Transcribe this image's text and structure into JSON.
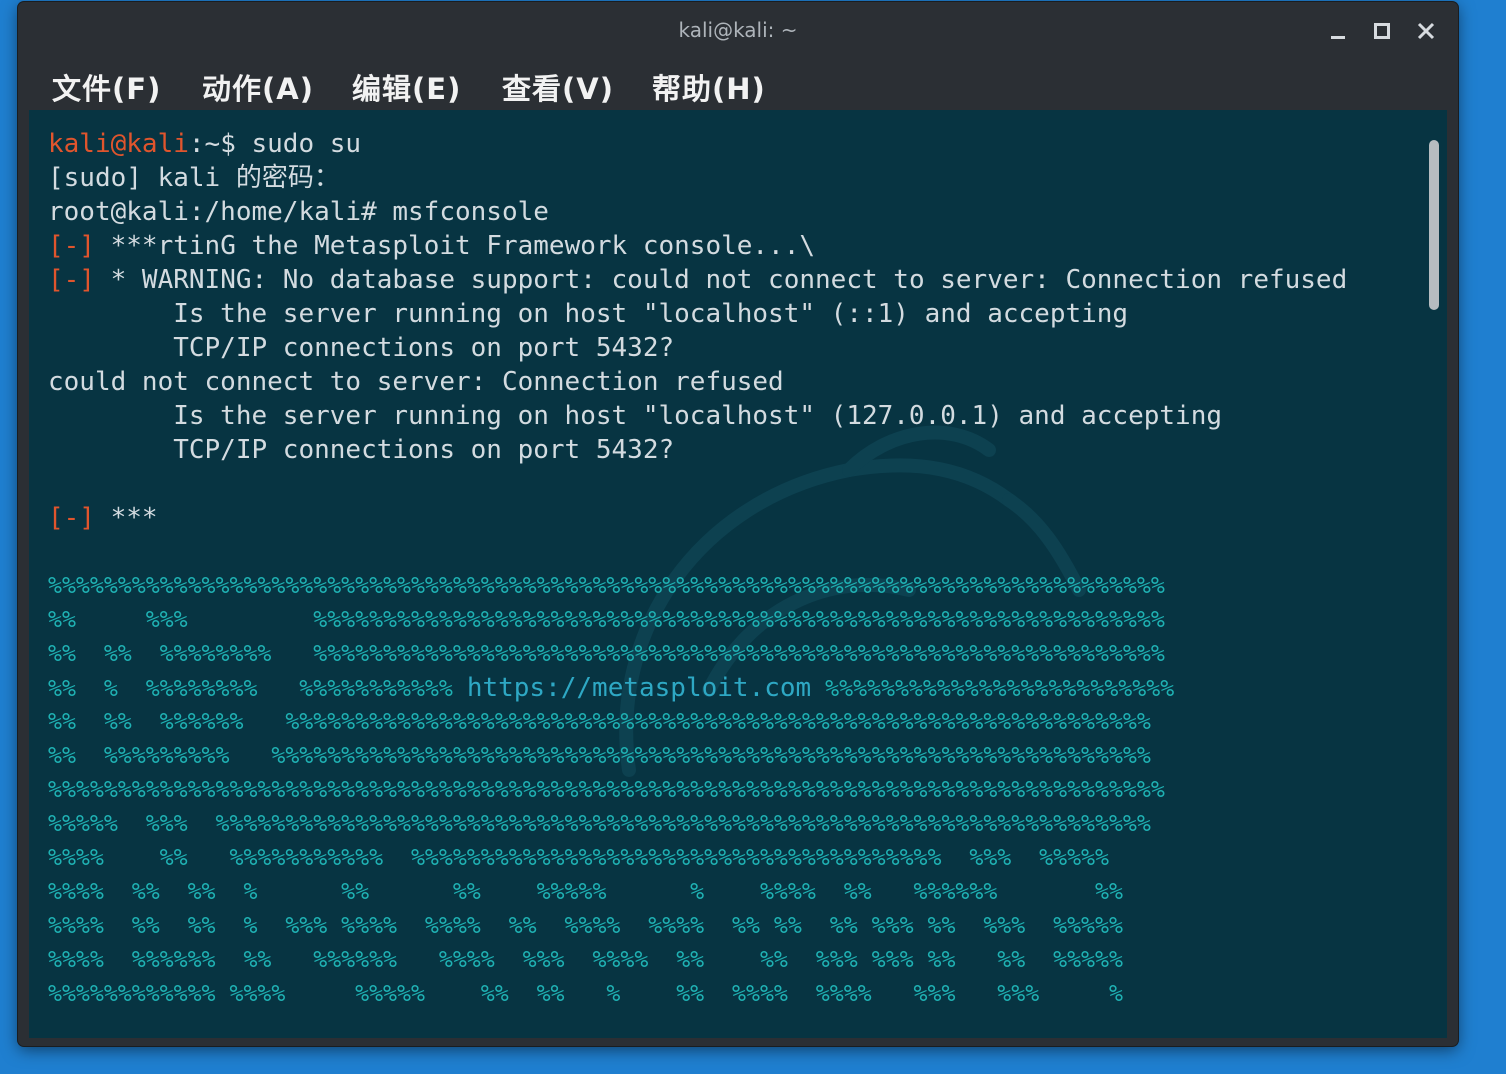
{
  "window": {
    "title": "kali@kali: ~",
    "controls": [
      "minimize-icon",
      "maximize-icon",
      "close-icon"
    ]
  },
  "menubar": {
    "items": [
      "文件(F)",
      "动作(A)",
      "编辑(E)",
      "查看(V)",
      "帮助(H)"
    ]
  },
  "terminal": {
    "prompt_user": "kali@kali",
    "prompt_rest": ":~$ sudo su",
    "sudo_prompt": "[sudo] kali 的密码：",
    "root_cmd": "root@kali:/home/kali# msfconsole",
    "err_tag": "[-]",
    "line_starting": " ***rtinG the Metasploit Framework console...\\",
    "line_warning": " * WARNING: No database support: could not connect to server: Connection refused",
    "line_host1": "        Is the server running on host \"localhost\" (::1) and accepting",
    "line_tcp1": "        TCP/IP connections on port 5432?",
    "line_could_not": "could not connect to server: Connection refused",
    "line_host2": "        Is the server running on host \"localhost\" (127.0.0.1) and accepting",
    "line_tcp2": "        TCP/IP connections on port 5432?",
    "line_stars": " ***"
  },
  "banner": {
    "line1": "%%%%%%%%%%%%%%%%%%%%%%%%%%%%%%%%%%%%%%%%%%%%%%%%%%%%%%%%%%%%%%%%%%%%%%%%%%%%%%%%",
    "line2": "%%     %%%         %%%%%%%%%%%%%%%%%%%%%%%%%%%%%%%%%%%%%%%%%%%%%%%%%%%%%%%%%%%%%",
    "line3": "%%  %%  %%%%%%%%   %%%%%%%%%%%%%%%%%%%%%%%%%%%%%%%%%%%%%%%%%%%%%%%%%%%%%%%%%%%%%",
    "line4_a": "%%  %  %%%%%%%%   %%%%%%%%%%% ",
    "line4_url": "https://metasploit.com",
    "line4_b": " %%%%%%%%%%%%%%%%%%%%%%%%%",
    "line5": "%%  %%  %%%%%%   %%%%%%%%%%%%%%%%%%%%%%%%%%%%%%%%%%%%%%%%%%%%%%%%%%%%%%%%%%%%%%",
    "line6": "%%  %%%%%%%%%   %%%%%%%%%%%%%%%%%%%%%%%%%%%%%%%%%%%%%%%%%%%%%%%%%%%%%%%%%%%%%%%",
    "line7": "%%%%%%%%%%%%%%%%%%%%%%%%%%%%%%%%%%%%%%%%%%%%%%%%%%%%%%%%%%%%%%%%%%%%%%%%%%%%%%%%",
    "line8": "%%%%%  %%%  %%%%%%%%%%%%%%%%%%%%%%%%%%%%%%%%%%%%%%%%%%%%%%%%%%%%%%%%%%%%%%%%%%%",
    "line9": "%%%%    %%   %%%%%%%%%%%  %%%%%%%%%%%%%%%%%%%%%%%%%%%%%%%%%%%%%%  %%%  %%%%%",
    "line10": "%%%%  %%  %%  %      %%      %%    %%%%%      %    %%%%  %%   %%%%%%       %%",
    "line11": "%%%%  %%  %%  %  %%% %%%%  %%%%  %%  %%%%  %%%%  %% %%  %% %%% %%  %%%  %%%%%",
    "line12": "%%%%  %%%%%%  %%   %%%%%%   %%%%  %%%  %%%%  %%    %%  %%% %%% %%   %%  %%%%%",
    "line13": "%%%%%%%%%%%% %%%%     %%%%%    %%  %%   %    %%  %%%%  %%%%   %%%   %%%     %"
  }
}
